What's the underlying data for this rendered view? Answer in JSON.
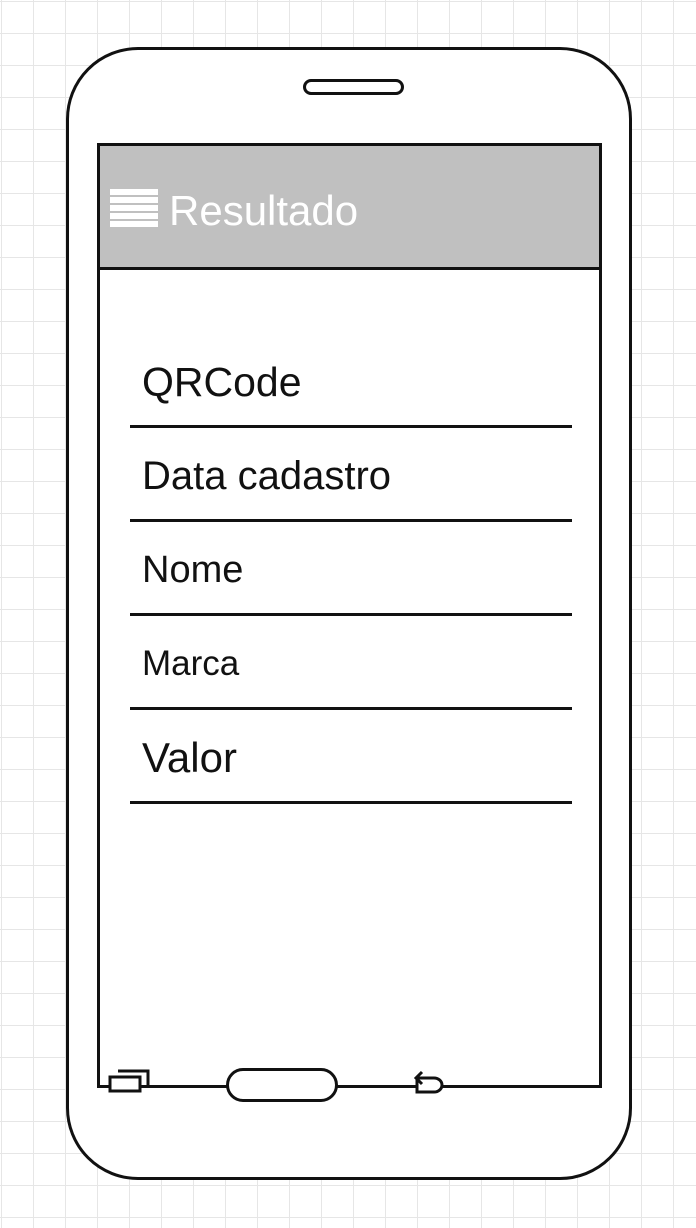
{
  "app_bar": {
    "title": "Resultado",
    "menu_icon": "hamburger-menu-icon",
    "background_color": "#c0c0c0"
  },
  "fields": [
    {
      "label": "QRCode"
    },
    {
      "label": "Data cadastro"
    },
    {
      "label": "Nome"
    },
    {
      "label": "Marca"
    },
    {
      "label": "Valor"
    }
  ],
  "nav_bar": {
    "recent_icon": "recent-apps-icon",
    "home_icon": "home-button",
    "back_icon": "back-icon"
  }
}
